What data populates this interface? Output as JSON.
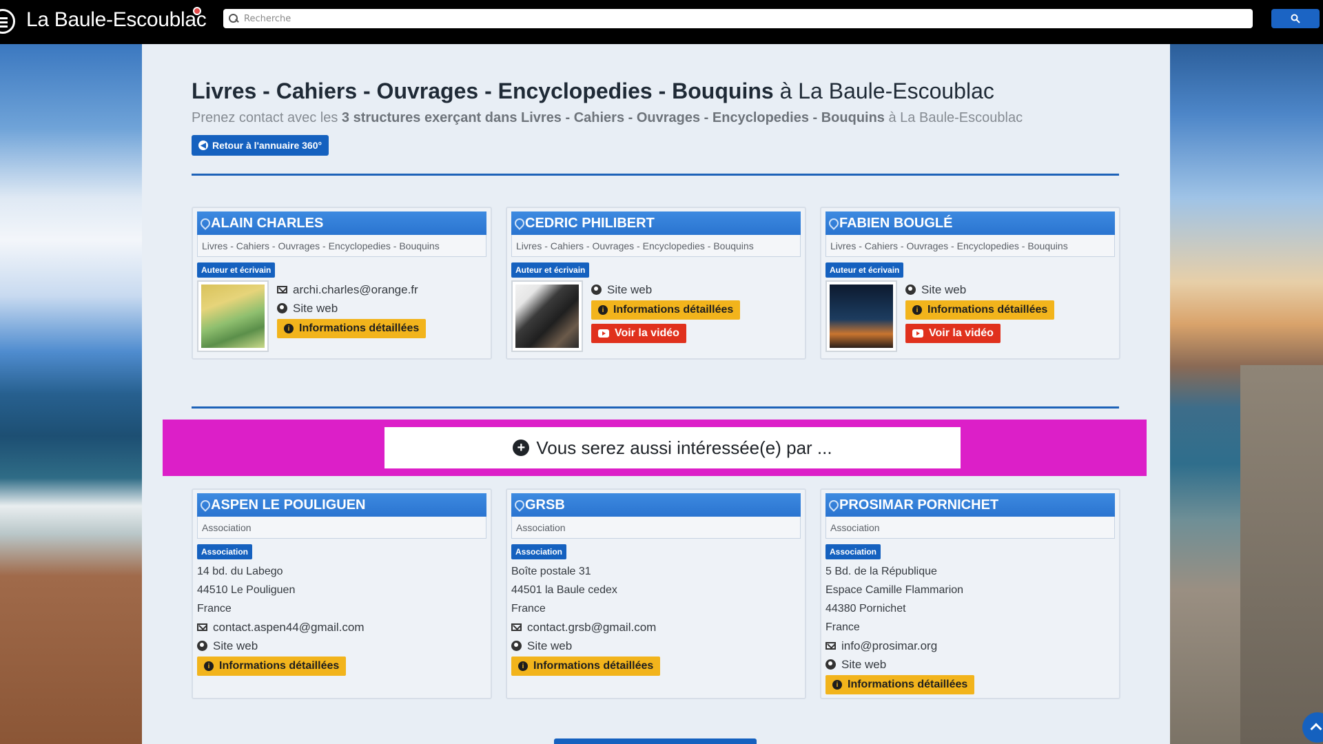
{
  "header": {
    "brand": "La Baule-Escoublac",
    "search_placeholder": "Recherche",
    "search_button_icon": "search-icon"
  },
  "page": {
    "title_main": "Livres - Cahiers - Ouvrages - Encyclopedies - Bouquins",
    "title_loc": " à La Baule-Escoublac",
    "subtitle_pre": "Prenez contact avec les ",
    "subtitle_bold": "3 structures exerçant dans Livres - Cahiers - Ouvrages - Encyclopedies - Bouquins",
    "subtitle_post": " à La Baule-Escoublac",
    "back_button": "Retour à l'annuaire 360°"
  },
  "cards": [
    {
      "name": "ALAIN CHARLES",
      "category": "Livres - Cahiers - Ouvrages - Encyclopedies - Bouquins",
      "badge": "Auteur et écrivain",
      "email": "archi.charles@orange.fr",
      "site": "Site web",
      "info": "Informations détaillées",
      "video": ""
    },
    {
      "name": "CEDRIC PHILIBERT",
      "category": "Livres - Cahiers - Ouvrages - Encyclopedies - Bouquins",
      "badge": "Auteur et écrivain",
      "site": "Site web",
      "info": "Informations détaillées",
      "video": "Voir la vidéo"
    },
    {
      "name": "FABIEN BOUGLÉ",
      "category": "Livres - Cahiers - Ouvrages - Encyclopedies - Bouquins",
      "badge": "Auteur et écrivain",
      "site": "Site web",
      "info": "Informations détaillées",
      "video": "Voir la vidéo"
    }
  ],
  "promo": {
    "text": "Vous serez aussi intéressée(e) par ..."
  },
  "related": [
    {
      "name": "ASPEN LE POULIGUEN",
      "category": "Association",
      "badge": "Association",
      "address": [
        "14 bd. du Labego",
        "44510 Le Pouliguen",
        "France"
      ],
      "email": "contact.aspen44@gmail.com",
      "site": "Site web",
      "info": "Informations détaillées"
    },
    {
      "name": "GRSB",
      "category": "Association",
      "badge": "Association",
      "address": [
        "Boîte postale 31",
        "44501 la Baule cedex",
        "France"
      ],
      "email": "contact.grsb@gmail.com",
      "site": "Site web",
      "info": "Informations détaillées"
    },
    {
      "name": "PROSIMAR PORNICHET",
      "category": "Association",
      "badge": "Association",
      "address": [
        "5 Bd. de la République",
        "Espace Camille Flammarion",
        "44380 Pornichet",
        "France"
      ],
      "email": "info@prosimar.org",
      "site": "Site web",
      "info": "Informations détaillées"
    }
  ],
  "colors": {
    "accent": "#1561bf",
    "promo": "#dc1fc8",
    "warning": "#f2b41c",
    "danger": "#e0311d"
  }
}
